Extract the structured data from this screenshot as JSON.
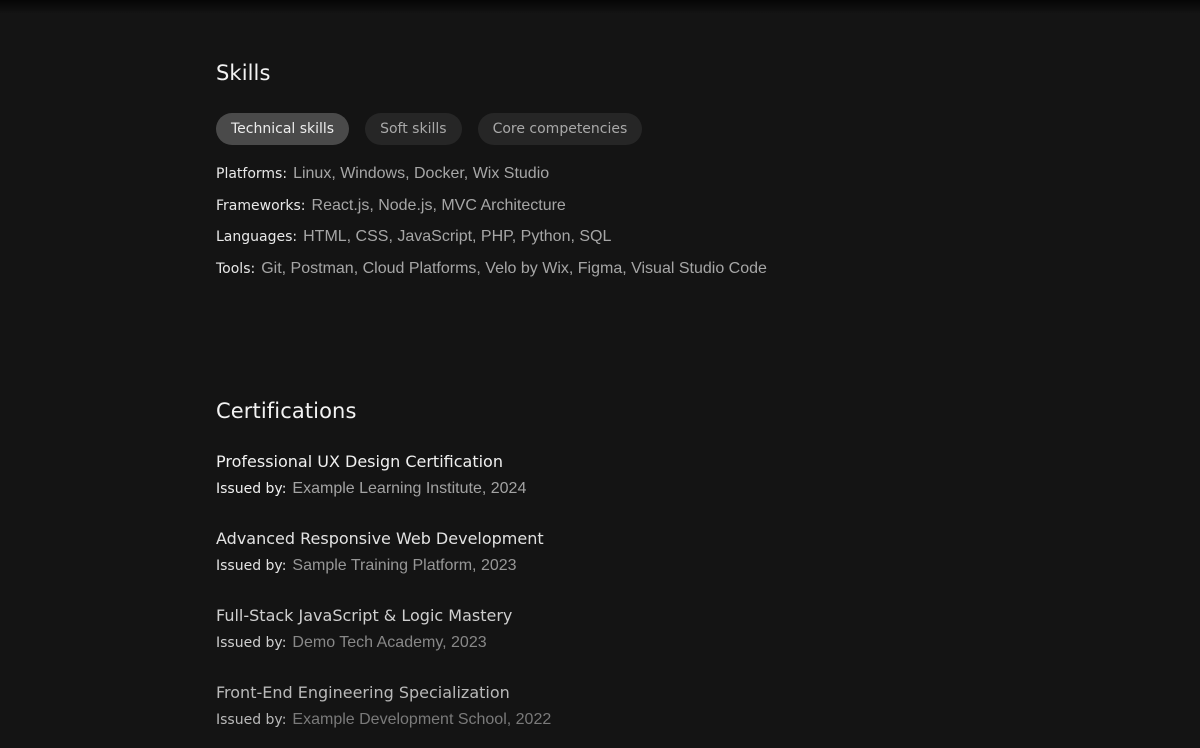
{
  "skills": {
    "heading": "Skills",
    "tabs": [
      {
        "label": "Technical skills",
        "active": true
      },
      {
        "label": "Soft skills",
        "active": false
      },
      {
        "label": "Core competencies",
        "active": false
      }
    ],
    "rows": [
      {
        "label": "Platforms:",
        "value": "Linux, Windows, Docker, Wix Studio"
      },
      {
        "label": "Frameworks:",
        "value": "React.js, Node.js, MVC Architecture"
      },
      {
        "label": "Languages:",
        "value": "HTML, CSS, JavaScript, PHP, Python, SQL"
      },
      {
        "label": "Tools:",
        "value": "Git, Postman, Cloud Platforms, Velo by Wix, Figma, Visual Studio Code"
      }
    ]
  },
  "certifications": {
    "heading": "Certifications",
    "items": [
      {
        "title": "Professional UX Design Certification",
        "issued_label": "Issued by:",
        "issuer": "Example Learning Institute, 2024"
      },
      {
        "title": "Advanced Responsive Web Development",
        "issued_label": "Issued by:",
        "issuer": "Sample Training Platform, 2023"
      },
      {
        "title": "Full-Stack JavaScript & Logic Mastery",
        "issued_label": "Issued by:",
        "issuer": "Demo Tech Academy, 2023"
      },
      {
        "title": "Front-End Engineering Specialization",
        "issued_label": "Issued by:",
        "issuer": "Example Development School, 2022"
      }
    ]
  },
  "colors": {
    "background": "#141414",
    "heading": "#f2f2f2",
    "tab_active_bg": "#4a4a4a",
    "tab_inactive_bg": "#262626"
  }
}
